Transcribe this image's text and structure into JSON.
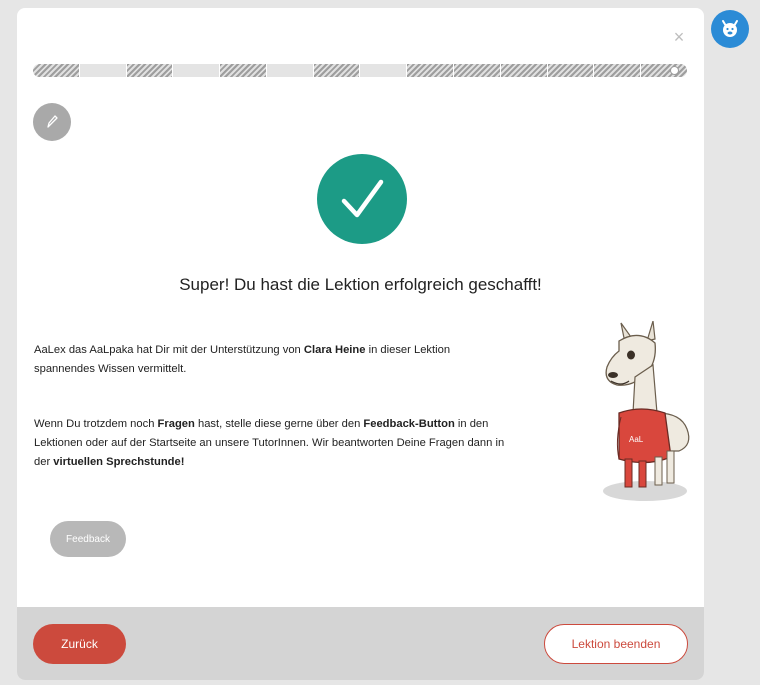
{
  "close_label": "×",
  "progress": {
    "segments": [
      "done",
      "todo",
      "done",
      "todo",
      "done",
      "todo",
      "done",
      "todo",
      "done",
      "done",
      "done",
      "done",
      "done",
      "done"
    ],
    "current_index": 13
  },
  "success": {
    "title": "Super! Du hast die Lektion erfolgreich geschafft!"
  },
  "paragraph1": {
    "t1": "AaLex das AaLpaka hat Dir mit der Unterstützung von ",
    "b1": "Clara Heine",
    "t2": " in dieser Lektion spannendes Wissen vermittelt."
  },
  "paragraph2": {
    "t1": "Wenn Du trotzdem noch ",
    "b1": "Fragen",
    "t2": " hast, stelle diese gerne über den ",
    "b2": "Feedback-Button",
    "t3": " in den Lektionen oder auf der Startseite an unsere TutorInnen. Wir beantworten Deine Fragen dann in der ",
    "b3": "virtuellen Sprechstunde!"
  },
  "mascot_text": "AaL",
  "buttons": {
    "feedback": "Feedback",
    "back": "Zurück",
    "finish": "Lektion beenden"
  },
  "colors": {
    "accent_red": "#cc4a3d",
    "success_green": "#1c9b86",
    "avatar_blue": "#2b8bd6"
  }
}
